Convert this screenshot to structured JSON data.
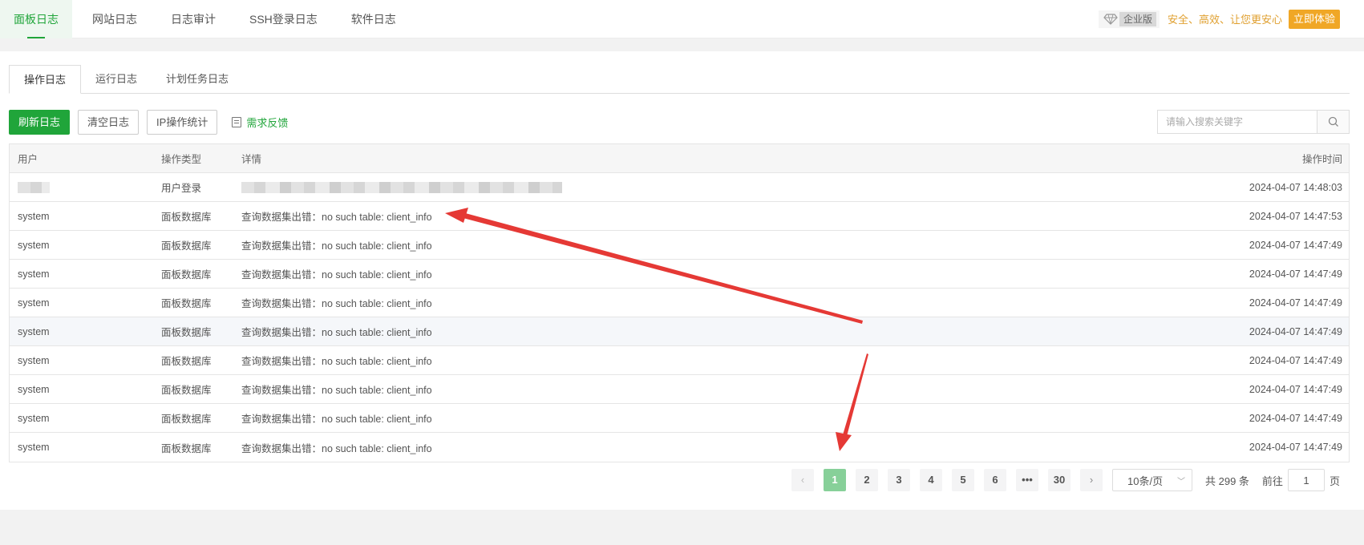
{
  "topnav": {
    "tabs": [
      {
        "label": "面板日志",
        "active": true
      },
      {
        "label": "网站日志"
      },
      {
        "label": "日志审计"
      },
      {
        "label": "SSH登录日志"
      },
      {
        "label": "软件日志"
      }
    ],
    "enterprise_label": "企业版",
    "slogan": "安全、高效、让您更安心",
    "try_button": "立即体验"
  },
  "subtabs": [
    {
      "label": "操作日志",
      "active": true
    },
    {
      "label": "运行日志"
    },
    {
      "label": "计划任务日志"
    }
  ],
  "toolbar": {
    "refresh": "刷新日志",
    "clear": "清空日志",
    "ip_stats": "IP操作统计",
    "feedback": "需求反馈"
  },
  "search": {
    "placeholder": "请输入搜索关键字"
  },
  "table": {
    "headers": [
      "用户",
      "操作类型",
      "详情",
      "操作时间"
    ],
    "rows": [
      {
        "user": "",
        "type": "用户登录",
        "detail": "",
        "time": "2024-04-07 14:48:03"
      },
      {
        "user": "system",
        "type": "面板数据库",
        "detail": "查询数据集出错：no such table: client_info",
        "time": "2024-04-07 14:47:53"
      },
      {
        "user": "system",
        "type": "面板数据库",
        "detail": "查询数据集出错：no such table: client_info",
        "time": "2024-04-07 14:47:49"
      },
      {
        "user": "system",
        "type": "面板数据库",
        "detail": "查询数据集出错：no such table: client_info",
        "time": "2024-04-07 14:47:49"
      },
      {
        "user": "system",
        "type": "面板数据库",
        "detail": "查询数据集出错：no such table: client_info",
        "time": "2024-04-07 14:47:49"
      },
      {
        "user": "system",
        "type": "面板数据库",
        "detail": "查询数据集出错：no such table: client_info",
        "time": "2024-04-07 14:47:49"
      },
      {
        "user": "system",
        "type": "面板数据库",
        "detail": "查询数据集出错：no such table: client_info",
        "time": "2024-04-07 14:47:49"
      },
      {
        "user": "system",
        "type": "面板数据库",
        "detail": "查询数据集出错：no such table: client_info",
        "time": "2024-04-07 14:47:49"
      },
      {
        "user": "system",
        "type": "面板数据库",
        "detail": "查询数据集出错：no such table: client_info",
        "time": "2024-04-07 14:47:49"
      },
      {
        "user": "system",
        "type": "面板数据库",
        "detail": "查询数据集出错：no such table: client_info",
        "time": "2024-04-07 14:47:49"
      }
    ]
  },
  "pagination": {
    "pages": [
      "1",
      "2",
      "3",
      "4",
      "5",
      "6",
      "•••",
      "30"
    ],
    "current": "1",
    "page_size": "10条/页",
    "total": "共 299 条",
    "goto_prefix": "前往",
    "goto_value": "1",
    "goto_suffix": "页"
  },
  "colors": {
    "accent": "#20a53a",
    "annotation": "#e53935",
    "enterprise": "#f0a726"
  }
}
